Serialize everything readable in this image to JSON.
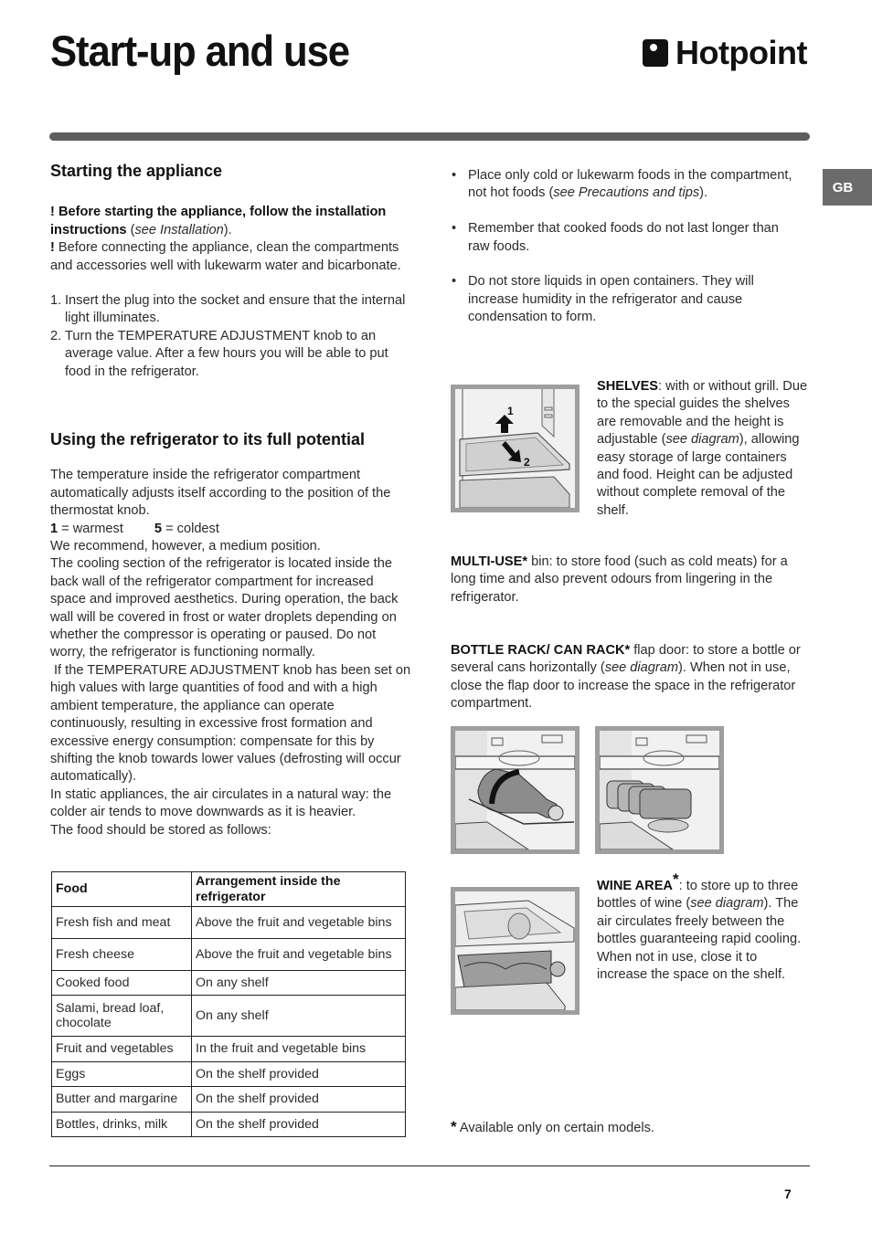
{
  "header": {
    "title": "Start-up and use",
    "brand": "Hotpoint",
    "language_tab": "GB"
  },
  "starting": {
    "heading": "Starting the appliance",
    "warning1_mark": "!",
    "warning1_bold": "Before starting the appliance, follow the installation instructions",
    "warning1_ref_open": " (",
    "warning1_ref": "see Installation",
    "warning1_ref_close": ").",
    "warning2_mark": "!",
    "warning2_text": " Before connecting the appliance, clean the compartments and accessories well with lukewarm water and bicarbonate.",
    "steps": [
      {
        "num": "1.",
        "text": "Insert the plug into the socket and ensure that the internal light illuminates."
      },
      {
        "num": "2.",
        "text": "Turn the TEMPERATURE ADJUSTMENT knob to an average value. After a few hours you will be able to put food in the refrigerator."
      }
    ]
  },
  "using": {
    "heading": "Using the refrigerator to its full potential",
    "intro": "The temperature inside the refrigerator compartment automatically adjusts itself according to the position of the thermostat knob.",
    "scale_warm_num": "1",
    "scale_warm_label": " = warmest",
    "scale_cold_num": "5",
    "scale_cold_label": " = coldest",
    "recommend": "We recommend, however, a medium position.",
    "cooling": "The cooling section of the refrigerator is located inside the back wall of the refrigerator compartment for increased space and improved aesthetics. During operation, the back wall will be covered in frost or water droplets depending on whether the compressor is operating or paused. Do not worry, the refrigerator is functioning normally.",
    "high_values": "If the TEMPERATURE ADJUSTMENT knob has been set on high values with large quantities of food and with a high ambient temperature, the appliance can operate continuously, resulting in excessive frost formation and excessive energy consumption: compensate for this by shifting the knob towards lower values (defrosting will occur automatically).",
    "static": "In static appliances, the air circulates in a natural way: the colder air tends to move downwards as it is heavier.",
    "stored_as": "The food should be stored as follows:"
  },
  "food_table": {
    "headers": [
      "Food",
      "Arrangement inside the refrigerator"
    ],
    "rows": [
      [
        "Fresh fish and meat",
        "Above the fruit and vegetable bins"
      ],
      [
        "Fresh cheese",
        "Above the fruit and vegetable bins"
      ],
      [
        "Cooked food",
        "On any shelf"
      ],
      [
        "Salami, bread loaf, chocolate",
        "On any shelf"
      ],
      [
        "Fruit and vegetables",
        "In the fruit and vegetable bins"
      ],
      [
        "Eggs",
        "On the shelf provided"
      ],
      [
        "Butter and margarine",
        "On the shelf provided"
      ],
      [
        "Bottles, drinks, milk",
        "On the shelf provided"
      ]
    ]
  },
  "tips": {
    "bullet": "•",
    "items": [
      {
        "text": "Place only cold or lukewarm foods in the compartment, not hot foods (",
        "ref": "see Precautions and tips",
        "after": ")."
      },
      {
        "text": "Remember that cooked foods do not last longer than raw foods.",
        "ref": "",
        "after": ""
      },
      {
        "text": "Do not store liquids in open containers. They will increase humidity in the refrigerator and cause condensation to form.",
        "ref": "",
        "after": ""
      }
    ]
  },
  "shelves": {
    "label": "SHELVES",
    "text1": ": with or without grill. Due to the special guides the shelves are removable and the height is adjustable (",
    "ref": "see diagram",
    "text2": "), allowing easy storage of large containers and food. Height can be adjusted without complete removal of the shelf.",
    "diagram_step1": "1",
    "diagram_step2": "2"
  },
  "multi_use": {
    "label": "MULTI-USE*",
    "text": " bin: to store food (such as cold meats) for a long time and also prevent odours from lingering in the refrigerator."
  },
  "bottle_rack": {
    "label": "BOTTLE RACK/ CAN RACK*",
    "text1": " flap door: to store a bottle or several cans horizontally (",
    "ref": "see diagram",
    "text2": "). When not in use, close the flap door to increase the space in the refrigerator compartment."
  },
  "wine_area": {
    "label": "WINE AREA",
    "star": "*",
    "text1": ": to store up to three bottles of wine (",
    "ref": "see diagram",
    "text2": "). The air circulates freely between the bottles guaranteeing rapid cooling. When not in use, close it to increase the space on the shelf."
  },
  "footnote": {
    "star": "*",
    "text": " Available only on certain models."
  },
  "footer": {
    "page_number": "7"
  }
}
